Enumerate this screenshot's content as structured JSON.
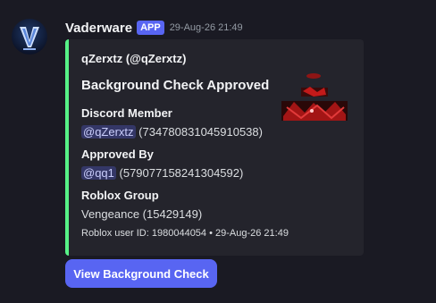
{
  "author": {
    "username": "Vaderware",
    "badge": "APP",
    "timestamp": "29-Aug-26 21:49",
    "avatar_icon": "vaderware-v-logo-icon"
  },
  "embed": {
    "accent_color": "#57f287",
    "author_line": "qZerxtz (@qZerxtz)",
    "title": "Background Check Approved",
    "thumbnail_icon": "red-dragon-image",
    "fields": [
      {
        "name": "Discord Member",
        "mention": "@qZerxtz",
        "value": "(734780831045910538)"
      },
      {
        "name": "Approved By",
        "mention": "@qq1",
        "value": "(579077158241304592)"
      },
      {
        "name": "Roblox Group",
        "value": "Vengeance (15429149)"
      }
    ],
    "footer": "Roblox user ID: 1980044054 • 29-Aug-26 21:49"
  },
  "button": {
    "label": "View Background Check",
    "color": "#5865f2"
  }
}
